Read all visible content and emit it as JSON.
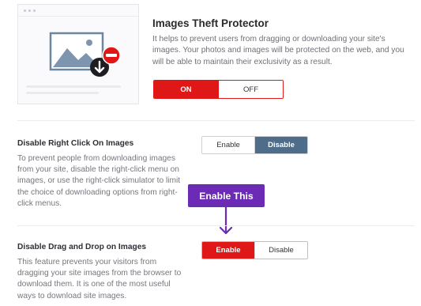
{
  "hero": {
    "title": "Images Theft Protector",
    "description": "It helps to prevent users from dragging or downloading your site's images. Your photos and images will be protected on the web, and you will be able to maintain their exclusivity as a result.",
    "on_label": "ON",
    "off_label": "OFF",
    "selected": "ON"
  },
  "sections": [
    {
      "title": "Disable Right Click On Images",
      "description_lines": [
        "To prevent people from downloading images",
        "from your site, disable the right-click menu on",
        "images, or use the right-click simulator to limit",
        "the choice of downloading options from right-",
        "click menus."
      ],
      "enable_label": "Enable",
      "disable_label": "Disable",
      "selected": "Disable"
    },
    {
      "title": "Disable Drag and Drop on Images",
      "description_lines": [
        "This feature prevents your visitors from",
        "dragging your site images from the browser to",
        "download them. It is one of the most useful",
        "ways to download site images."
      ],
      "enable_label": "Enable",
      "disable_label": "Disable",
      "selected": "Enable"
    }
  ],
  "callout": {
    "text": "Enable This"
  },
  "colors": {
    "on_red": "#e01717",
    "selected_slate": "#4d6d8a",
    "callout_purple": "#6c2bb4"
  },
  "icons": {
    "illustration": "image-blocked-illustration",
    "download": "download-icon",
    "block": "no-entry-icon",
    "arrow": "arrow-down-icon"
  }
}
